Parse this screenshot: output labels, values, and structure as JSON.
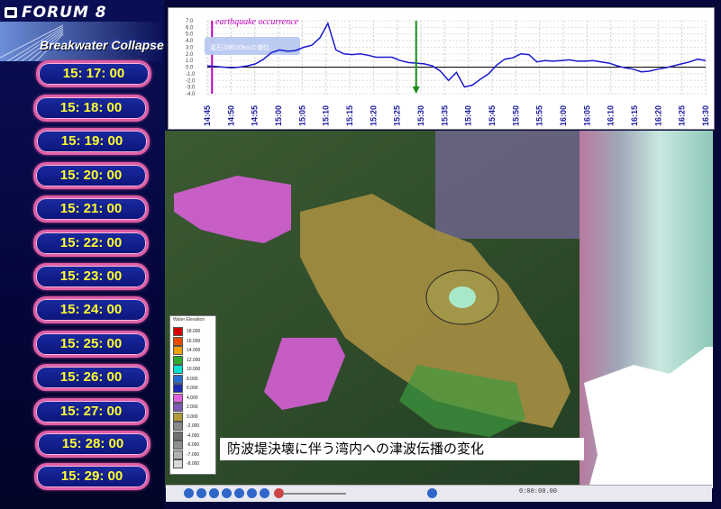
{
  "app": {
    "logo_text": "FORUM 8",
    "subtitle": "Breakwater Collapse"
  },
  "sidebar": {
    "times": [
      "15: 17: 00",
      "15: 18: 00",
      "15: 19: 00",
      "15: 20: 00",
      "15: 21: 00",
      "15: 22: 00",
      "15: 23: 00",
      "15: 24: 00",
      "15: 25: 00",
      "15: 26: 00",
      "15: 27: 00",
      "15: 28: 00",
      "15: 29: 00"
    ]
  },
  "chart_data": {
    "type": "line",
    "title": "earthquake occurrence",
    "annotation": "釜石沖約20kmの潮位",
    "x_ticks": [
      "14:45",
      "14:50",
      "14:55",
      "15:00",
      "15:05",
      "15:10",
      "15:15",
      "15:20",
      "15:25",
      "15:30",
      "15:35",
      "15:40",
      "15:45",
      "15:50",
      "15:55",
      "16:00",
      "16:05",
      "16:10",
      "16:15",
      "16:20",
      "16:25",
      "16:30"
    ],
    "y_ticks": [
      "7.0",
      "6.0",
      "5.0",
      "4.0",
      "3.0",
      "2.0",
      "1.0",
      "0.0",
      "-1.0",
      "-2.0",
      "-3.0",
      "-4.0"
    ],
    "ylim": [
      -4,
      7
    ],
    "markers": {
      "earthquake_time": "14:46",
      "current_time": "15:29"
    },
    "series": [
      {
        "values": [
          0.2,
          0.1,
          0.0,
          -0.1,
          0.0,
          0.2,
          0.5,
          1.2,
          2.2,
          2.6,
          2.4,
          2.5,
          3.0,
          3.3,
          4.4,
          6.6,
          2.6,
          2.0,
          1.9,
          2.0,
          1.8,
          1.5,
          1.5,
          1.5,
          1.0,
          0.7,
          0.6,
          0.5,
          0.2,
          -0.6,
          -2.0,
          -0.8,
          -3.0,
          -2.7,
          -1.8,
          -1.0,
          0.3,
          1.2,
          1.4,
          2.0,
          1.9,
          0.8,
          1.0,
          0.9,
          1.0,
          1.1,
          0.9,
          0.9,
          1.0,
          0.8,
          0.6,
          0.2,
          -0.1,
          -0.3,
          -0.7,
          -0.6,
          -0.3,
          -0.1,
          0.2,
          0.5,
          0.8,
          1.2,
          1.0
        ],
        "x_start": "14:45",
        "x_end": "16:30",
        "color": "#1a1ad0"
      }
    ]
  },
  "map": {
    "legend_title": "Water Elevation",
    "legend": [
      {
        "label": "18.000",
        "color": "#d40000"
      },
      {
        "label": "16.000",
        "color": "#e84a00"
      },
      {
        "label": "14.000",
        "color": "#f0a000"
      },
      {
        "label": "12.000",
        "color": "#2ea82e"
      },
      {
        "label": "10.000",
        "color": "#00e0d0"
      },
      {
        "label": "8.000",
        "color": "#2a6bd0"
      },
      {
        "label": "6.000",
        "color": "#1a2bb0"
      },
      {
        "label": "4.000",
        "color": "#e060e0"
      },
      {
        "label": "2.000",
        "color": "#7a5ab0"
      },
      {
        "label": "0.000",
        "color": "#b09a3a"
      },
      {
        "label": "-2.000",
        "color": "#8a8a8a"
      },
      {
        "label": "-4.000",
        "color": "#707070"
      },
      {
        "label": "-6.000",
        "color": "#909090"
      },
      {
        "label": "-7.000",
        "color": "#b0b0b0"
      },
      {
        "label": "-8.000",
        "color": "#d8d8d8"
      }
    ],
    "caption": "防波堤決壊に伴う湾内への津波伝播の変化"
  },
  "toolbar": {
    "time": "0:00:00.00"
  }
}
